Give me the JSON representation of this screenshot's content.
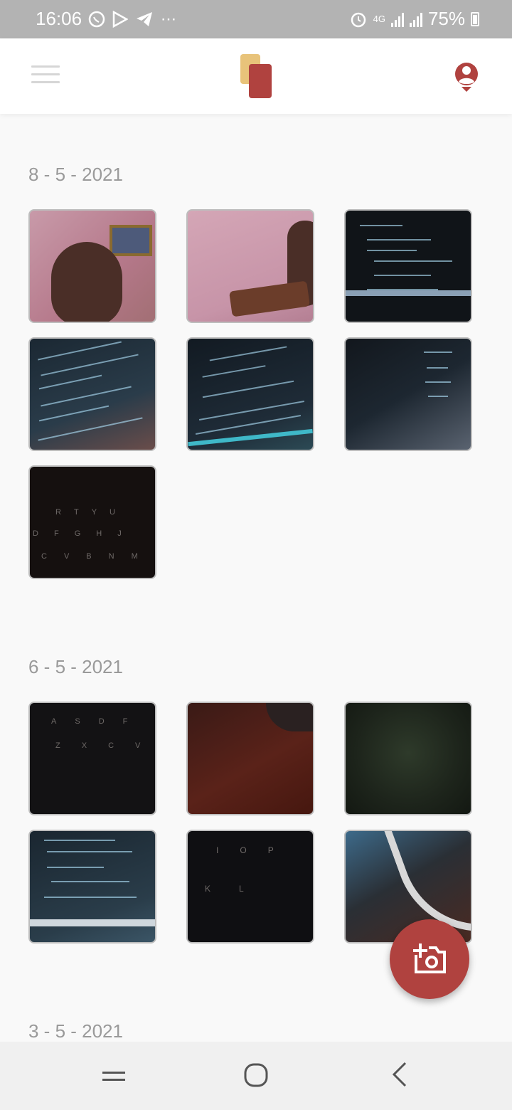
{
  "status_bar": {
    "time": "16:06",
    "left_icons": [
      "whatsapp-icon",
      "play-store-icon",
      "telegram-icon",
      "more-dots-icon"
    ],
    "network": "4G",
    "battery": "75%"
  },
  "app_bar": {
    "menu_icon": "hamburger-menu-icon",
    "logo": "app-logo",
    "profile_icon": "account-icon",
    "accent": "#b0423f",
    "logo_secondary": "#e8c37a"
  },
  "sections": [
    {
      "date": "8 - 5 - 2021",
      "photo_count": 7
    },
    {
      "date": "6 - 5 - 2021",
      "photo_count": 6
    },
    {
      "date": "3 - 5 - 2021"
    }
  ],
  "fab": {
    "icon": "add-photo-camera-icon"
  },
  "nav_bar": {
    "recents_icon": "recents-icon",
    "home_icon": "home-icon",
    "back_icon": "back-icon"
  },
  "keyboard_keys": {
    "photo7_row1": [
      "R",
      "T",
      "Y",
      "U"
    ],
    "photo7_row2": [
      "D",
      "F",
      "G",
      "H",
      "J"
    ],
    "photo7_row3": [
      "C",
      "V",
      "B",
      "N",
      "M"
    ],
    "photo8_row1": [
      "A",
      "S",
      "D",
      "F"
    ],
    "photo8_row2": [
      "Z",
      "X",
      "C",
      "V"
    ],
    "photo12_row1": [
      "I",
      "O",
      "P"
    ],
    "photo12_row2": [
      "K",
      "L"
    ]
  }
}
